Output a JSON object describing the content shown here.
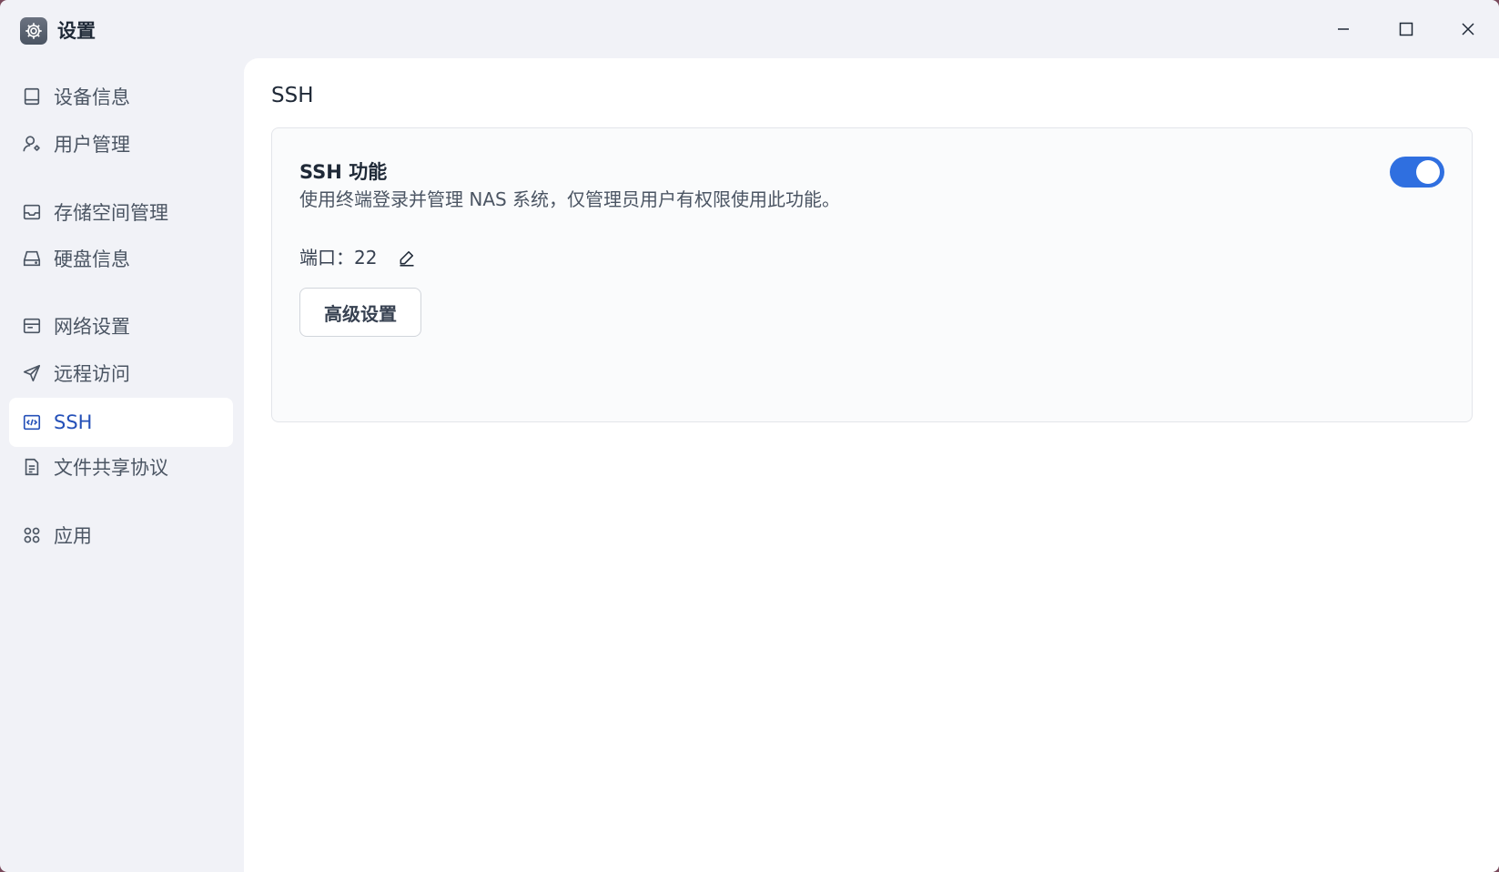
{
  "window": {
    "title": "设置",
    "icon": "gear-icon",
    "controls": [
      "minimize-icon",
      "maximize-icon",
      "close-icon"
    ]
  },
  "sidebar": {
    "items": [
      {
        "label": "设备信息",
        "icon": "device-info-icon",
        "active": false
      },
      {
        "label": "用户管理",
        "icon": "user-icon",
        "active": false
      },
      {
        "label": "存储空间管理",
        "icon": "storage-tray-icon",
        "active": false
      },
      {
        "label": "硬盘信息",
        "icon": "hard-disk-icon",
        "active": false
      },
      {
        "label": "网络设置",
        "icon": "network-icon",
        "active": false
      },
      {
        "label": "远程访问",
        "icon": "send-icon",
        "active": false
      },
      {
        "label": "SSH",
        "icon": "code-icon",
        "active": true
      },
      {
        "label": "文件共享协议",
        "icon": "document-icon",
        "active": false
      },
      {
        "label": "应用",
        "icon": "apps-icon",
        "active": false
      }
    ]
  },
  "main": {
    "title": "SSH",
    "card": {
      "feature_title": "SSH 功能",
      "feature_desc": "使用终端登录并管理 NAS 系统，仅管理员用户有权限使用此功能。",
      "enabled": true,
      "port_label": "端口：",
      "port_value": "22",
      "advanced_button": "高级设置"
    }
  },
  "colors": {
    "accent": "#2f6fe0",
    "active_text": "#2450b8",
    "sidebar_bg": "#f1f2f7"
  }
}
